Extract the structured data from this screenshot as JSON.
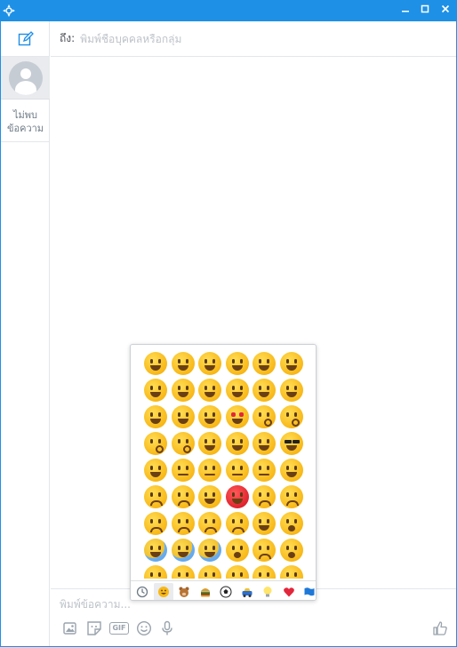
{
  "titlebar": {
    "controls": {
      "minimize": "−",
      "maximize": "□",
      "close": "✕"
    }
  },
  "sidebar": {
    "compose_icon": "compose-icon",
    "contact_icon": "avatar-placeholder-icon",
    "empty_text_line1": "ไม่พบ",
    "empty_text_line2": "ข้อความ"
  },
  "recipient": {
    "label": "ถึง:",
    "placeholder": "พิมพ์ชื่อบุคคลหรือกลุ่ม"
  },
  "composer": {
    "placeholder": "พิมพ์ข้อความ...",
    "tools": [
      "photo-icon",
      "sticker-icon",
      "gif-icon",
      "emoji-icon",
      "microphone-icon"
    ],
    "gif_label": "GIF",
    "like_icon": "thumbs-up-icon"
  },
  "emoji_picker": {
    "rows": [
      [
        "grinning",
        "grimacing",
        "beaming",
        "joy",
        "smiley",
        "smile"
      ],
      [
        "sweat-smile",
        "laughing",
        "halo",
        "wink",
        "blush",
        "slight-smile"
      ],
      [
        "relieved",
        "yum",
        "smirk-relieved",
        "heart-eyes",
        "kiss-heart",
        "kissing"
      ],
      [
        "kissing-smile",
        "kissing-closed",
        "tongue-wink",
        "tongue-closed",
        "tongue",
        "sunglasses"
      ],
      [
        "smirk",
        "no-mouth",
        "neutral",
        "expressionless",
        "unamused",
        "eye-roll"
      ],
      [
        "disappointed",
        "worried",
        "angry",
        "rage",
        "pensive",
        "confused"
      ],
      [
        "persevere",
        "confounded",
        "tired",
        "weary",
        "triumph",
        "open-mouth"
      ],
      [
        "scream",
        "fearful",
        "cold-sweat",
        "hushed",
        "frowning",
        "anguished"
      ],
      [
        "cry",
        "relaxed-partial",
        "sleepy",
        "sweat",
        "sob",
        "dizzy"
      ]
    ],
    "categories": [
      {
        "icon": "recent-clock-icon",
        "active": false
      },
      {
        "icon": "smiley-category-icon",
        "active": true
      },
      {
        "icon": "animal-bear-icon",
        "active": false
      },
      {
        "icon": "food-burger-icon",
        "active": false
      },
      {
        "icon": "sports-ball-icon",
        "active": false
      },
      {
        "icon": "car-icon",
        "active": false
      },
      {
        "icon": "lightbulb-icon",
        "active": false
      },
      {
        "icon": "heart-icon",
        "active": false
      },
      {
        "icon": "flag-icon",
        "active": false
      }
    ]
  },
  "colors": {
    "frame": "#1e90e6",
    "accent": "#1e8ee6",
    "icon_gray": "#9aa3ad"
  }
}
